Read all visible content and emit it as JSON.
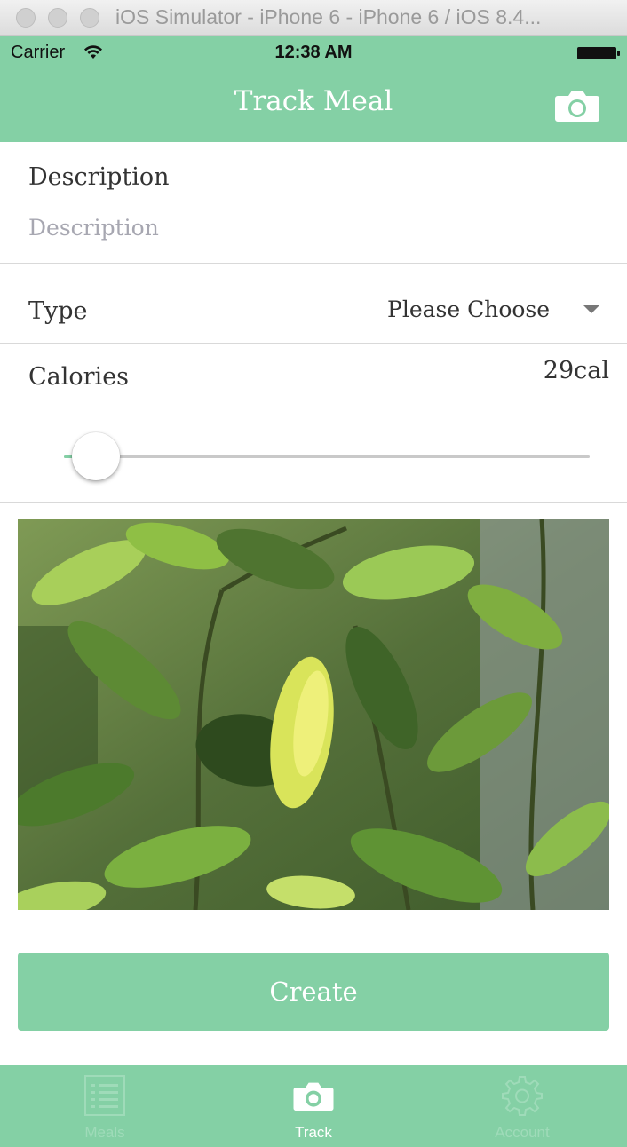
{
  "window": {
    "title": "iOS Simulator - iPhone 6 - iPhone 6 / iOS 8.4..."
  },
  "status_bar": {
    "carrier": "Carrier",
    "time": "12:38 AM"
  },
  "nav": {
    "title": "Track Meal",
    "camera_icon": "camera-icon"
  },
  "form": {
    "description": {
      "label": "Description",
      "value": "",
      "placeholder": "Description"
    },
    "type": {
      "label": "Type",
      "selected": "Please Choose"
    },
    "calories": {
      "label": "Calories",
      "value_text": "29cal",
      "slider_fraction": 0.06
    }
  },
  "photo": {
    "subject": "leaves"
  },
  "create_label": "Create",
  "tabs": [
    {
      "label": "Meals",
      "icon": "list-icon",
      "active": false
    },
    {
      "label": "Track",
      "icon": "camera-icon",
      "active": true
    },
    {
      "label": "Account",
      "icon": "gear-icon",
      "active": false
    }
  ],
  "colors": {
    "accent": "#84d0a5",
    "tab_inactive_text": "#9fdbb9",
    "placeholder": "#a7a7b1"
  }
}
